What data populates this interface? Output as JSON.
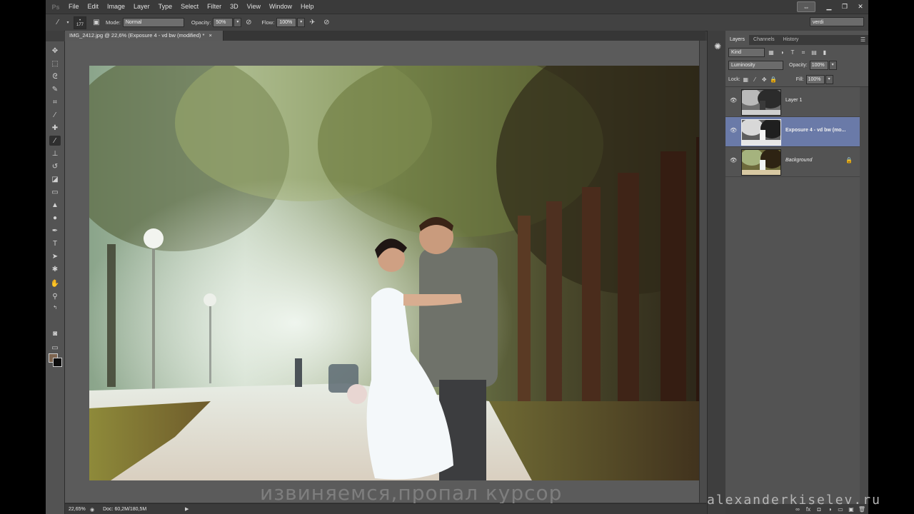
{
  "menubar": {
    "logo": "Ps",
    "items": [
      "File",
      "Edit",
      "Image",
      "Layer",
      "Type",
      "Select",
      "Filter",
      "3D",
      "View",
      "Window",
      "Help"
    ]
  },
  "options": {
    "brush_size": "177",
    "mode_label": "Mode:",
    "mode_value": "Normal",
    "opacity_label": "Opacity:",
    "opacity_value": "50%",
    "flow_label": "Flow:",
    "flow_value": "100%",
    "workspace": "verdi"
  },
  "document": {
    "tab_title": "IMG_2412.jpg @ 22,6% (Exposure 4 - vd bw (modified) *",
    "tab_close": "×",
    "zoom": "22,65%",
    "doc_info": "Doc: 60,2M/180,5M",
    "overlay_text": "извиняемся,пропал курсор"
  },
  "layers_panel": {
    "tabs": [
      "Layers",
      "Channels",
      "History"
    ],
    "kind": "Kind",
    "blend_mode": "Luminosity",
    "opacity_label": "Opacity:",
    "opacity_value": "100%",
    "lock_label": "Lock:",
    "fill_label": "Fill:",
    "fill_value": "100%",
    "layers": [
      {
        "name": "Layer 1"
      },
      {
        "name": "Exposure 4 - vd bw (mo..."
      },
      {
        "name": "Background"
      }
    ]
  },
  "watermark": "alexanderkiselev.ru",
  "colors": {
    "foreground": "#7d6550",
    "background": "#0c0c0c",
    "selection": "#6a7aa8"
  }
}
